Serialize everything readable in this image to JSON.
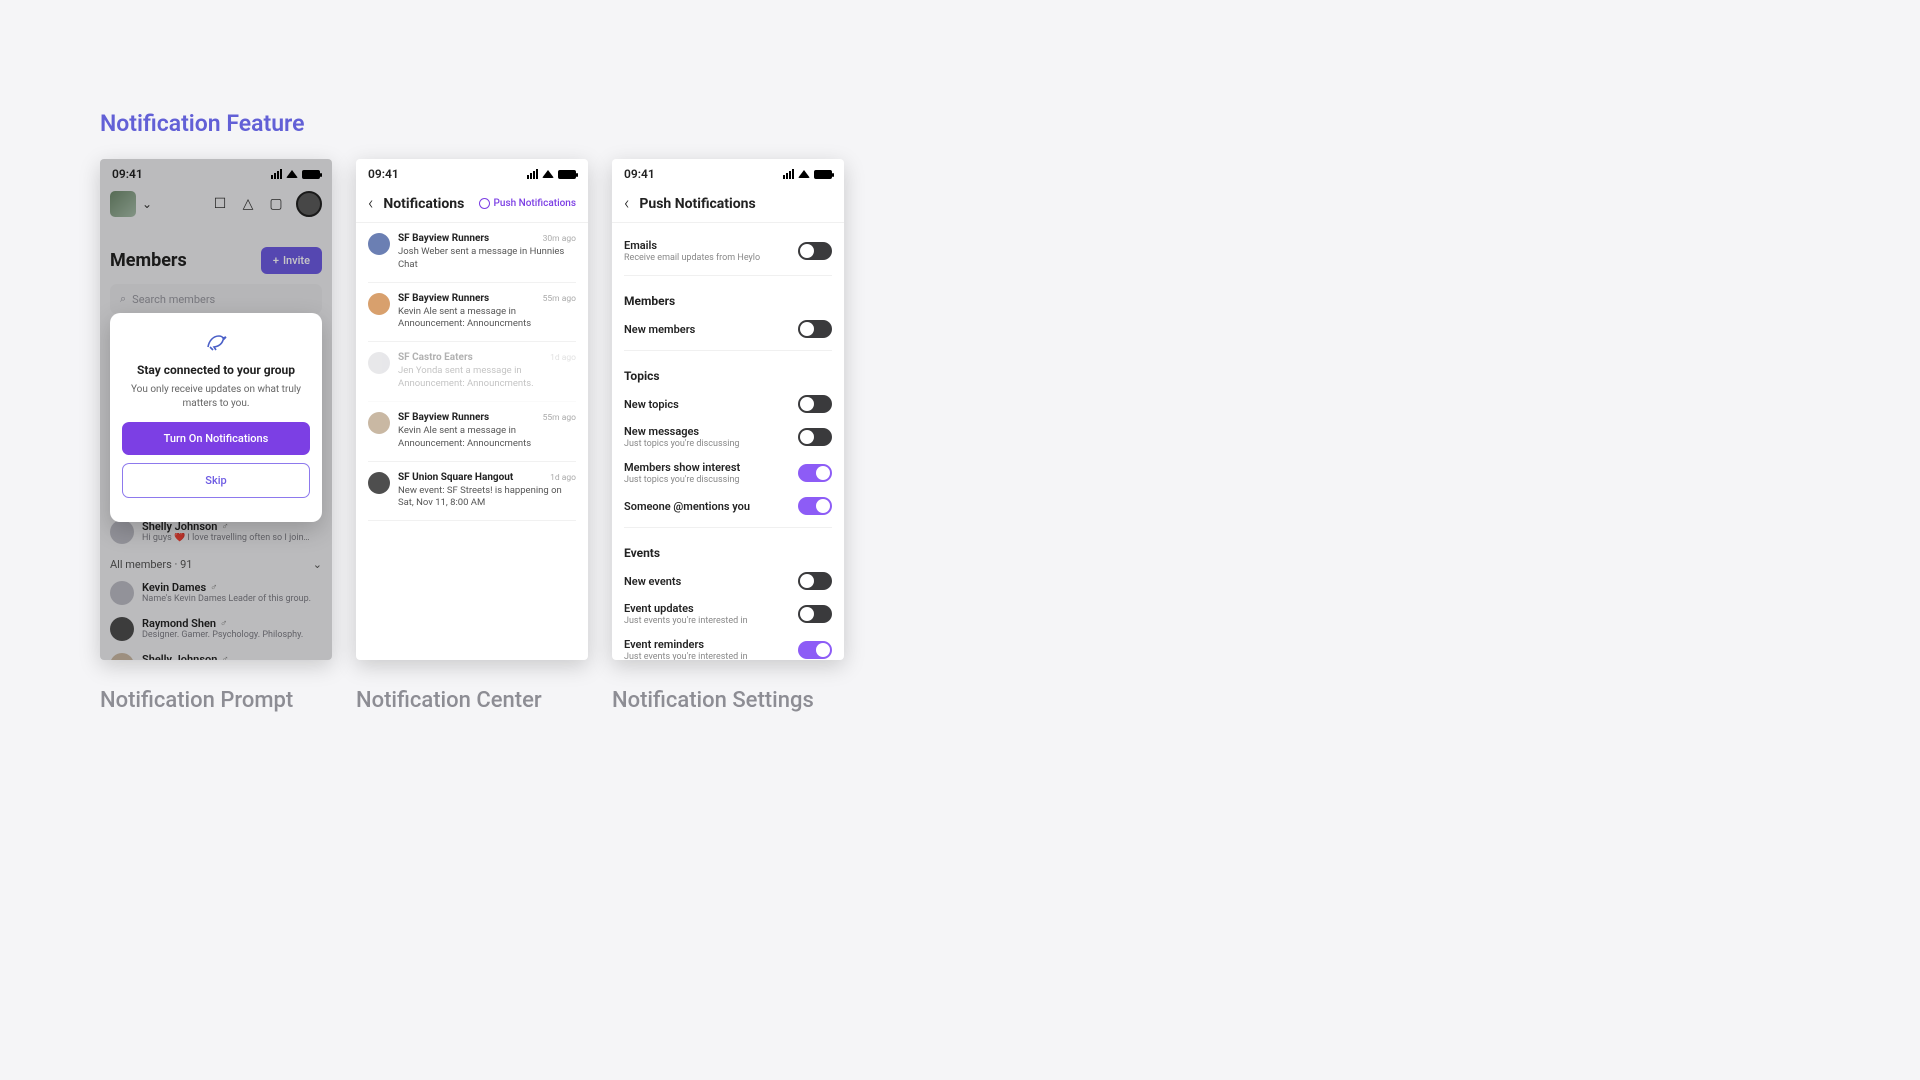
{
  "page_title": "Notification Feature",
  "status_time": "09:41",
  "captions": {
    "s1": "Notification Prompt",
    "s2": "Notification Center",
    "s3": "Notification Settings"
  },
  "s1": {
    "members_title": "Members",
    "invite": "Invite",
    "search_placeholder": "Search members",
    "all_members": "All members · 91",
    "modal": {
      "title": "Stay connected to your group",
      "body": "You only receive updates on what truly matters to you.",
      "primary": "Turn On Notifications",
      "secondary": "Skip"
    },
    "members": [
      {
        "name": "Shelly Johnson",
        "desc": "Hi guys ❤️ I love travelling often so I joined th…"
      },
      {
        "name": "Kevin Dames",
        "desc": "Name's Kevin Dames Leader of this group."
      },
      {
        "name": "Raymond Shen",
        "desc": "Designer. Gamer. Psychology. Philosphy."
      },
      {
        "name": "Shelly Johnson",
        "desc": ""
      }
    ]
  },
  "s2": {
    "title": "Notifications",
    "link": "Push Notifications",
    "items": [
      {
        "group": "SF Bayview Runners",
        "time": "30m ago",
        "msg": "Josh Weber sent a message in Hunnies Chat",
        "faded": false,
        "shape": "round"
      },
      {
        "group": "SF Bayview Runners",
        "time": "55m ago",
        "msg": "Kevin Ale sent a message in Announcement: Announcments",
        "faded": false,
        "shape": "round"
      },
      {
        "group": "SF Castro Eaters",
        "time": "1d ago",
        "msg": "Jen Yonda sent a message in Announcement: Announcments.",
        "faded": true,
        "shape": "sq"
      },
      {
        "group": "SF Bayview Runners",
        "time": "55m ago",
        "msg": "Kevin Ale sent a message in Announcement: Announcments",
        "faded": false,
        "shape": "round"
      },
      {
        "group": "SF Union Square Hangout",
        "time": "1d ago",
        "msg": "New event: SF Streets! is happening on Sat, Nov 11, 8:00 AM",
        "faded": false,
        "shape": "sq"
      }
    ]
  },
  "s3": {
    "title": "Push Notifications",
    "emails_label": "Emails",
    "emails_sub": "Receive email updates from Heylo",
    "sections": [
      {
        "heading": "Members",
        "rows": [
          {
            "label": "New members",
            "sub": "",
            "on": false
          }
        ]
      },
      {
        "heading": "Topics",
        "rows": [
          {
            "label": "New topics",
            "sub": "",
            "on": false
          },
          {
            "label": "New messages",
            "sub": "Just topics you're discussing",
            "on": false
          },
          {
            "label": "Members show interest",
            "sub": "Just topics you're discussing",
            "on": true
          },
          {
            "label": "Someone @mentions you",
            "sub": "",
            "on": true
          }
        ]
      },
      {
        "heading": "Events",
        "rows": [
          {
            "label": "New events",
            "sub": "",
            "on": false
          },
          {
            "label": "Event updates",
            "sub": "Just events you're interested in",
            "on": false
          },
          {
            "label": "Event reminders",
            "sub": "Just events you're interested in",
            "on": true
          }
        ]
      }
    ]
  }
}
